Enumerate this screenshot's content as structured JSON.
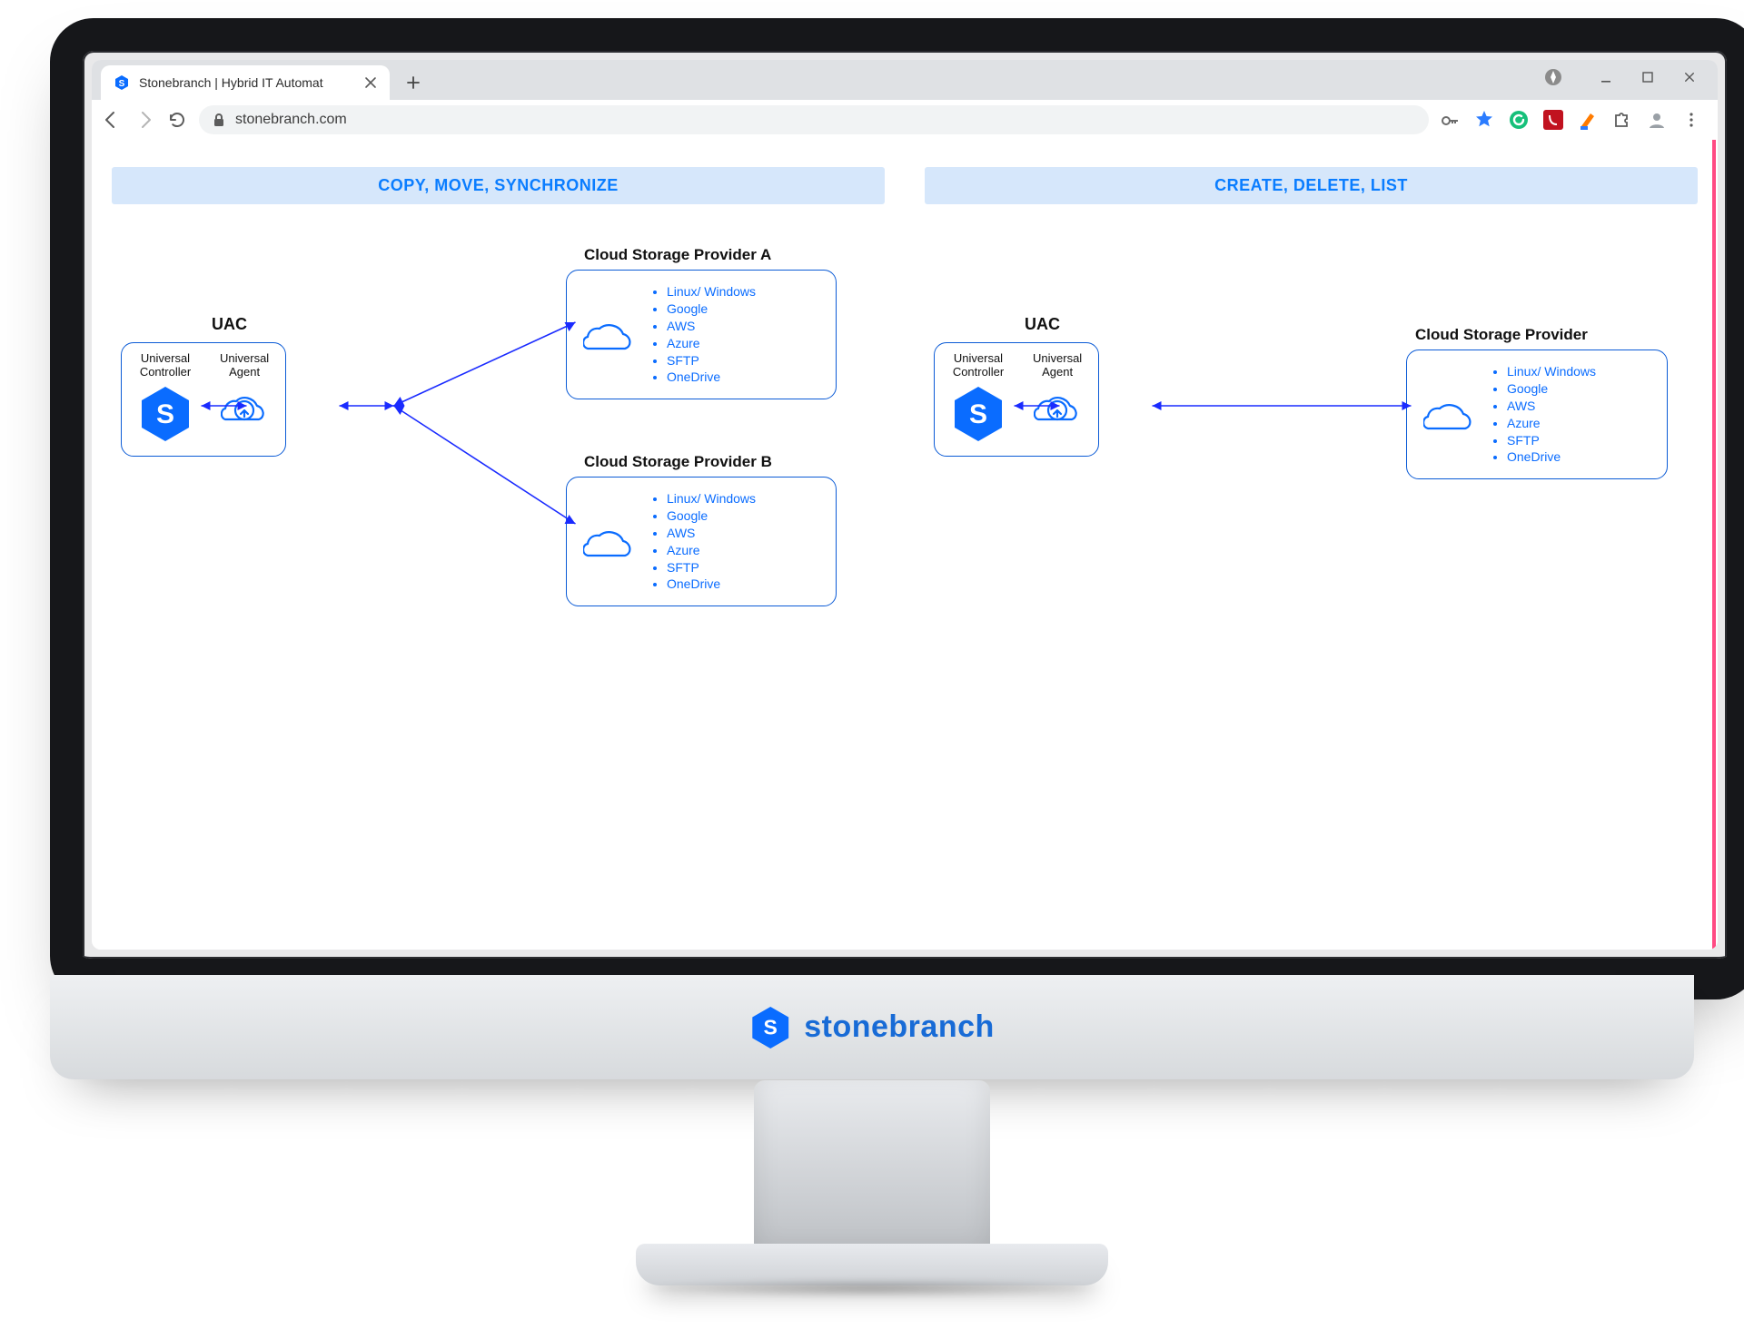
{
  "browser": {
    "tab_title": "Stonebranch | Hybrid IT Automat",
    "url_host": "stonebranch.com",
    "icons": {
      "favicon": "stonebranch-favicon",
      "back": "back-arrow",
      "forward": "forward-arrow",
      "reload": "reload",
      "lock": "lock",
      "key": "key",
      "star": "star",
      "ext_grammarly": "grammarly-ext",
      "ext_pdf": "acrobat-ext",
      "ext_marker": "marker-ext",
      "ext_puzzle": "extensions",
      "profile": "profile-avatar",
      "menu": "kebab-menu",
      "compass": "compass-icon"
    },
    "window": {
      "min": "minimize",
      "max": "maximize",
      "close": "close"
    }
  },
  "chin_logo": "stonebranch",
  "diagrams": {
    "left": {
      "header": "COPY, MOVE, SYNCHRONIZE",
      "uac": {
        "title": "UAC",
        "controller_label": "Universal\nController",
        "agent_label": "Universal\nAgent"
      },
      "provider_a": {
        "title": "Cloud Storage Provider A",
        "items": [
          "Linux/ Windows",
          "Google",
          "AWS",
          "Azure",
          "SFTP",
          "OneDrive"
        ]
      },
      "provider_b": {
        "title": "Cloud Storage Provider B",
        "items": [
          "Linux/ Windows",
          "Google",
          "AWS",
          "Azure",
          "SFTP",
          "OneDrive"
        ]
      }
    },
    "right": {
      "header": "CREATE, DELETE, LIST",
      "uac": {
        "title": "UAC",
        "controller_label": "Universal\nController",
        "agent_label": "Universal\nAgent"
      },
      "provider": {
        "title": "Cloud Storage Provider",
        "items": [
          "Linux/ Windows",
          "Google",
          "AWS",
          "Azure",
          "SFTP",
          "OneDrive"
        ]
      }
    }
  }
}
